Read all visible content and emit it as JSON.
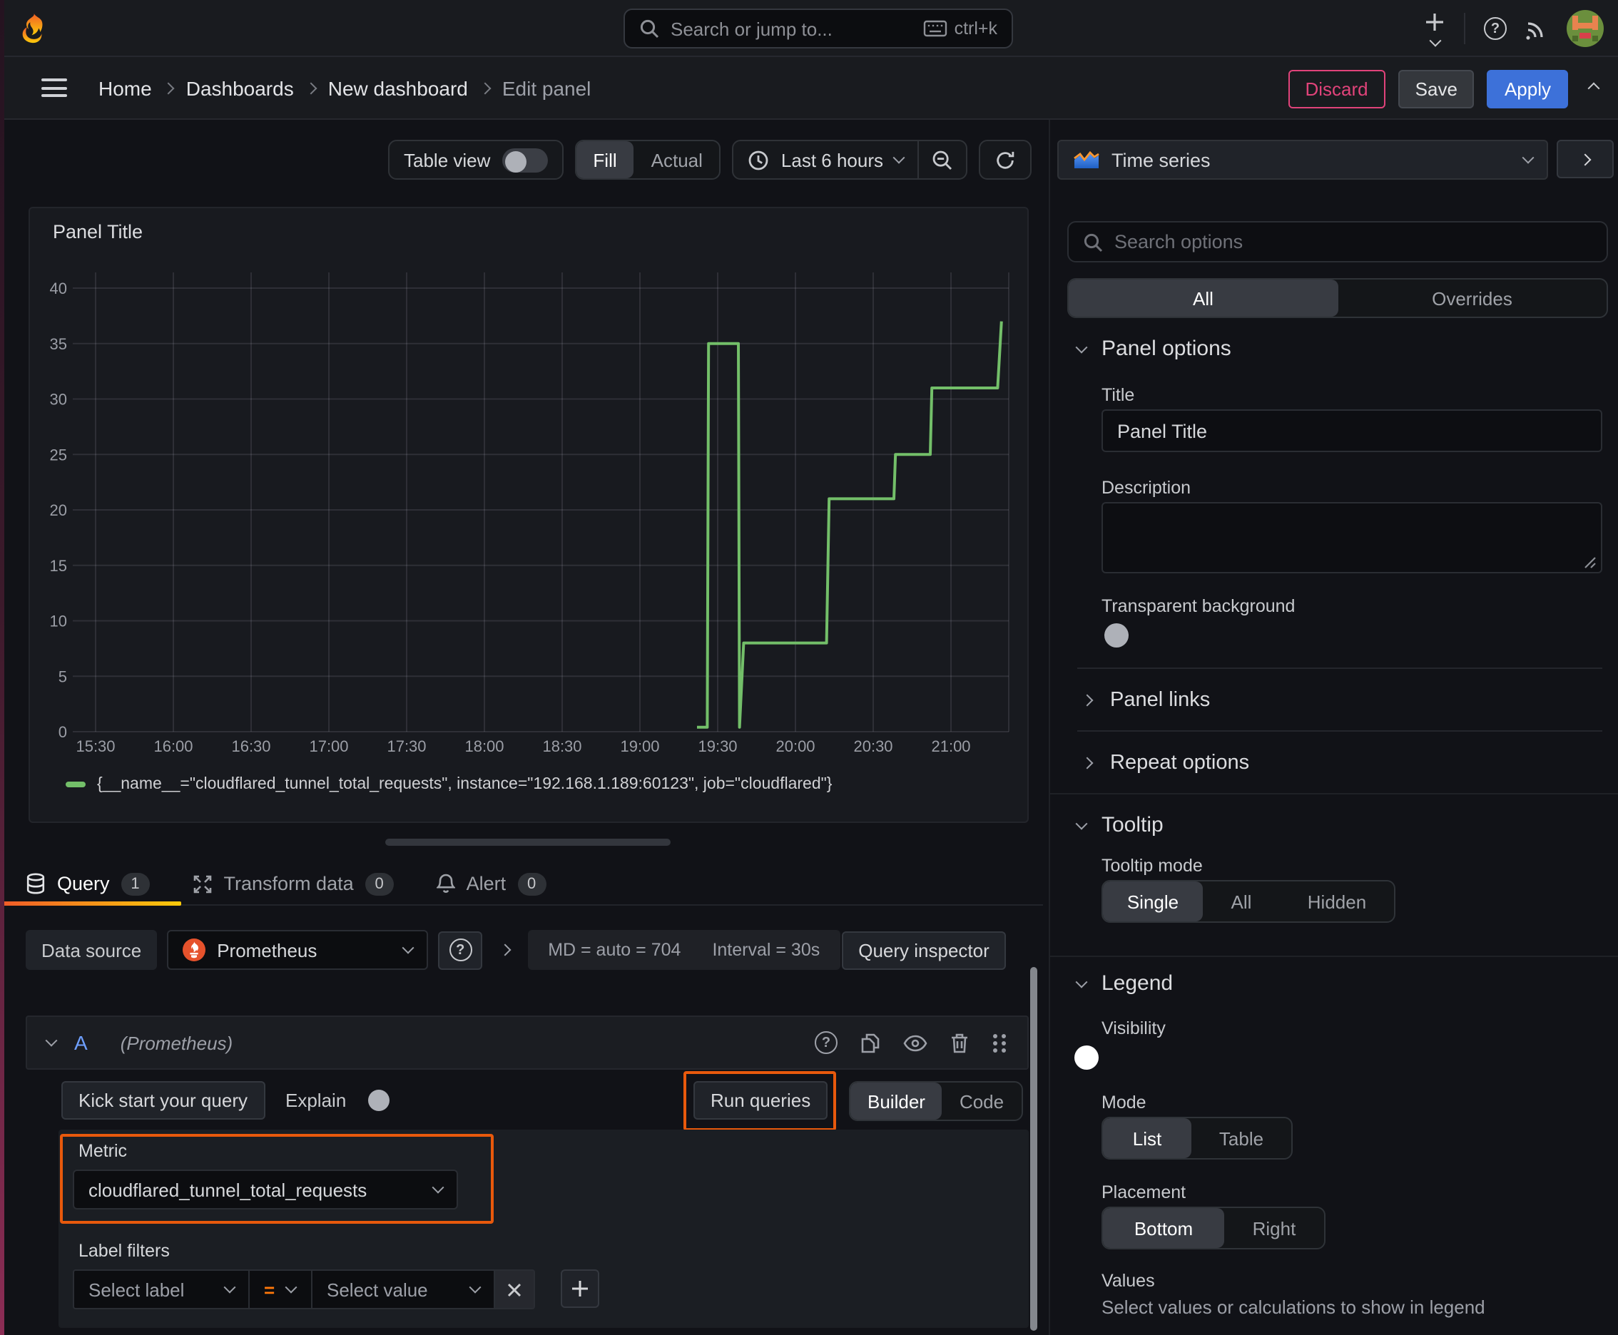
{
  "topnav": {
    "search_placeholder": "Search or jump to...",
    "shortcut": "ctrl+k"
  },
  "breadcrumb": {
    "items": [
      "Home",
      "Dashboards",
      "New dashboard",
      "Edit panel"
    ]
  },
  "actions": {
    "discard": "Discard",
    "save": "Save",
    "apply": "Apply"
  },
  "panel_toolbar": {
    "table_view": "Table view",
    "fill": "Fill",
    "actual": "Actual",
    "time_range": "Last 6 hours"
  },
  "viz_picker": {
    "value": "Time series"
  },
  "options_pane": {
    "search_placeholder": "Search options",
    "tab_all": "All",
    "tab_overrides": "Overrides",
    "panel_options": {
      "heading": "Panel options",
      "title_label": "Title",
      "title_value": "Panel Title",
      "description_label": "Description",
      "transparent_label": "Transparent background",
      "panel_links": "Panel links",
      "repeat_options": "Repeat options"
    },
    "tooltip": {
      "heading": "Tooltip",
      "mode_label": "Tooltip mode",
      "single": "Single",
      "all": "All",
      "hidden": "Hidden"
    },
    "legend": {
      "heading": "Legend",
      "visibility_label": "Visibility",
      "mode_label": "Mode",
      "list": "List",
      "table": "Table",
      "placement_label": "Placement",
      "bottom": "Bottom",
      "right": "Right",
      "values_label": "Values",
      "values_hint": "Select values or calculations to show in legend"
    }
  },
  "panel": {
    "title": "Panel Title"
  },
  "tabs": {
    "query": "Query",
    "query_count": "1",
    "transform": "Transform data",
    "transform_count": "0",
    "alert": "Alert",
    "alert_count": "0"
  },
  "datasource_row": {
    "label": "Data source",
    "name": "Prometheus",
    "stats": "MD = auto = 704",
    "interval": "Interval = 30s",
    "inspector": "Query inspector"
  },
  "query_editor": {
    "ref_id": "A",
    "ds_hint": "(Prometheus)",
    "kick_start": "Kick start your query",
    "explain": "Explain",
    "run_queries": "Run queries",
    "builder": "Builder",
    "code": "Code",
    "metric_label": "Metric",
    "metric_value": "cloudflared_tunnel_total_requests",
    "filters_label": "Label filters",
    "select_label": "Select label",
    "operator": "=",
    "select_value": "Select value"
  },
  "chart_data": {
    "type": "line",
    "step": true,
    "title": "Panel Title",
    "xlabel": "",
    "ylabel": "",
    "ylim": [
      0,
      40
    ],
    "grid": true,
    "legend_position": "bottom",
    "line_color": "#73bf69",
    "x_ticks": [
      "15:30",
      "16:00",
      "16:30",
      "17:00",
      "17:30",
      "18:00",
      "18:30",
      "19:00",
      "19:30",
      "20:00",
      "20:30",
      "21:00"
    ],
    "x_tick_minutes": [
      0,
      30,
      60,
      90,
      120,
      150,
      180,
      210,
      240,
      270,
      300,
      330
    ],
    "y_ticks": [
      0,
      5,
      10,
      15,
      20,
      25,
      30,
      35,
      40
    ],
    "x_unit": "minutes since 15:30",
    "series": [
      {
        "name": "{__name__=\"cloudflared_tunnel_total_requests\", instance=\"192.168.1.189:60123\", job=\"cloudflared\"}",
        "points_min_value": [
          [
            232,
            0.4
          ],
          [
            236,
            0.4
          ],
          [
            236.5,
            35
          ],
          [
            248,
            35
          ],
          [
            248.4,
            0.4
          ],
          [
            250,
            8
          ],
          [
            282,
            8
          ],
          [
            283,
            21
          ],
          [
            308,
            21
          ],
          [
            308.6,
            25
          ],
          [
            322,
            25
          ],
          [
            322.6,
            31
          ],
          [
            348,
            31
          ],
          [
            349.5,
            37
          ]
        ]
      }
    ]
  }
}
